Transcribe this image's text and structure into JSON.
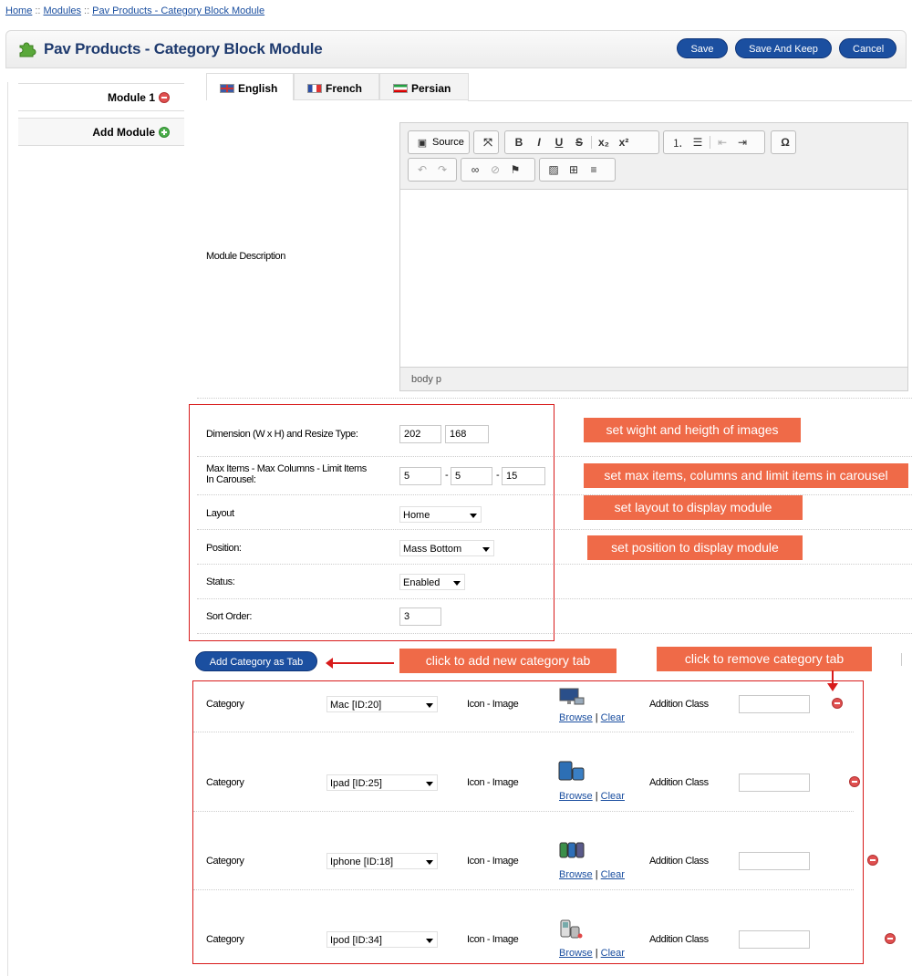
{
  "breadcrumb": {
    "items": [
      "Home",
      "Modules",
      "Pav Products - Category Block Module"
    ],
    "sep": "::"
  },
  "header": {
    "title": "Pav Products - Category Block Module",
    "save": "Save",
    "save_keep": "Save And Keep",
    "cancel": "Cancel"
  },
  "sidebar": {
    "module1": "Module 1",
    "add_module": "Add Module"
  },
  "tabs": [
    {
      "label": "English"
    },
    {
      "label": "French"
    },
    {
      "label": "Persian"
    }
  ],
  "editor": {
    "label": "Module Description",
    "source": "Source",
    "status": "body  p"
  },
  "form": {
    "dimension": {
      "label": "Dimension (W x H) and Resize Type:",
      "w": "202",
      "h": "168"
    },
    "max": {
      "label_line1": "Max Items - Max Columns - Limit Items",
      "label_line2": "In Carousel:",
      "items": "5",
      "columns": "5",
      "limit": "15",
      "dash": "-"
    },
    "layout": {
      "label": "Layout",
      "value": "Home"
    },
    "position": {
      "label": "Position:",
      "value": "Mass Bottom"
    },
    "status": {
      "label": "Status:",
      "value": "Enabled"
    },
    "sort": {
      "label": "Sort Order:",
      "value": "3"
    }
  },
  "callouts": {
    "dimension": "set wight and heigth of images",
    "max": "set max items, columns and limit items in carousel",
    "layout": "set layout to display module",
    "position": "set position to display module",
    "add_tab": "click to add new category tab",
    "remove_tab": "click to remove category tab"
  },
  "add_category_button": "Add Category as Tab",
  "categories": [
    {
      "label": "Category",
      "value": "Mac [ID:20]",
      "icon_label": "Icon - Image",
      "browse": "Browse",
      "sep": "|",
      "clear": "Clear",
      "class_label": "Addition Class",
      "class_value": ""
    },
    {
      "label": "Category",
      "value": "Ipad [ID:25]",
      "icon_label": "Icon - Image",
      "browse": "Browse",
      "sep": "|",
      "clear": "Clear",
      "class_label": "Addition Class",
      "class_value": ""
    },
    {
      "label": "Category",
      "value": "Iphone [ID:18]",
      "icon_label": "Icon - Image",
      "browse": "Browse",
      "sep": "|",
      "clear": "Clear",
      "class_label": "Addition Class",
      "class_value": ""
    },
    {
      "label": "Category",
      "value": "Ipod [ID:34]",
      "icon_label": "Icon - Image",
      "browse": "Browse",
      "sep": "|",
      "clear": "Clear",
      "class_label": "Addition Class",
      "class_value": ""
    }
  ],
  "colors": {
    "accent": "#1b4fa0",
    "callout": "#ef6a48",
    "annotation": "#d81b1b"
  }
}
